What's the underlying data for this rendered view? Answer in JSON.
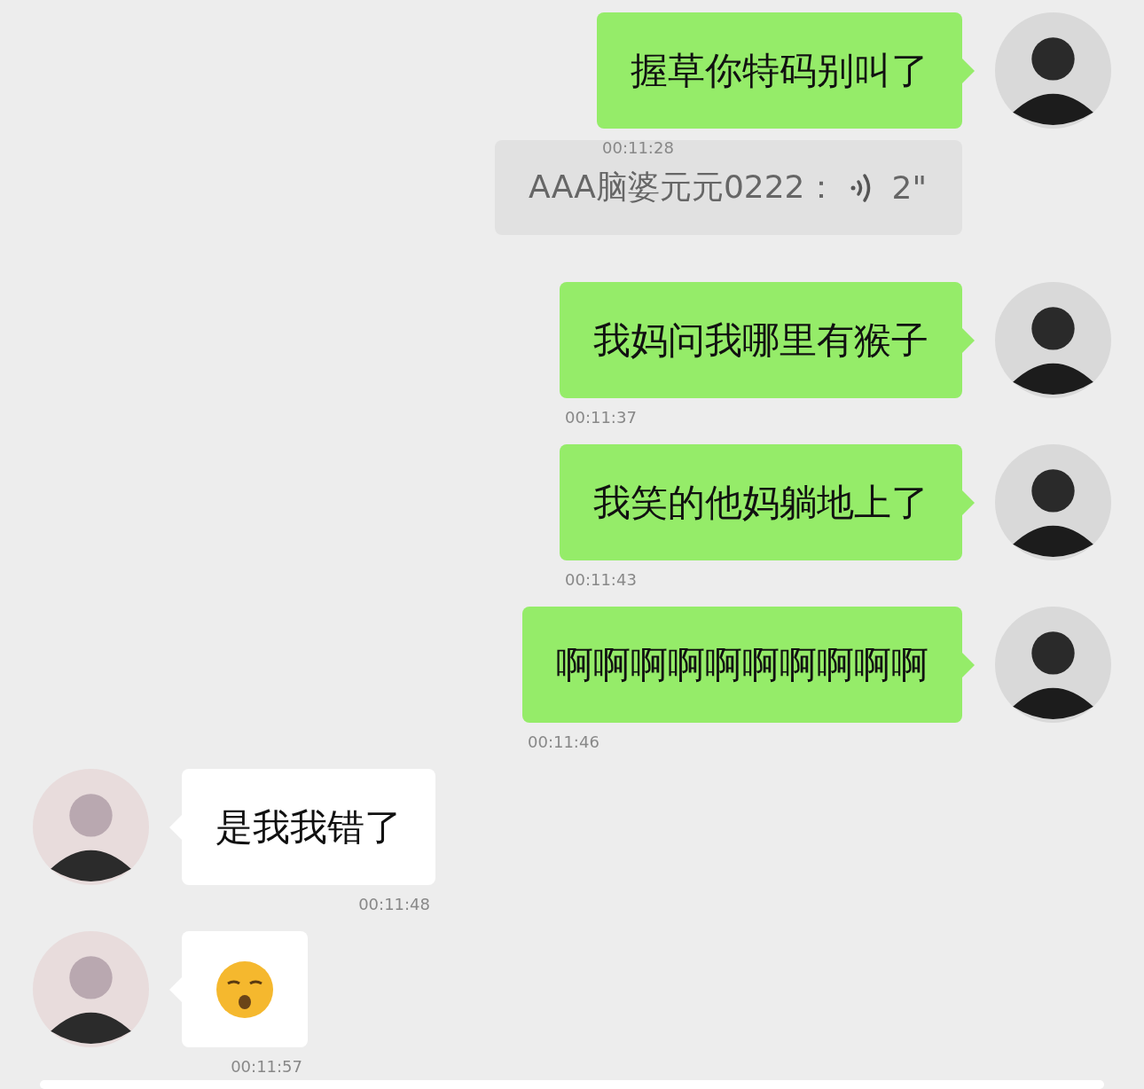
{
  "messages": [
    {
      "outgoing": true,
      "kind": "text",
      "text": "握草你特码别叫了",
      "time": "00:11:28"
    },
    {
      "outgoing": true,
      "kind": "quote",
      "sender": "AAA脑婆元元0222：",
      "duration": "2\""
    },
    {
      "outgoing": true,
      "kind": "text",
      "text": "我妈问我哪里有猴子",
      "time": "00:11:37"
    },
    {
      "outgoing": true,
      "kind": "text",
      "text": "我笑的他妈躺地上了",
      "time": "00:11:43"
    },
    {
      "outgoing": true,
      "kind": "text",
      "text": "啊啊啊啊啊啊啊啊啊啊",
      "time": "00:11:46"
    },
    {
      "outgoing": false,
      "kind": "text",
      "text": "是我我错了",
      "time": "00:11:48"
    },
    {
      "outgoing": false,
      "kind": "emoji",
      "time": "00:11:57"
    }
  ]
}
